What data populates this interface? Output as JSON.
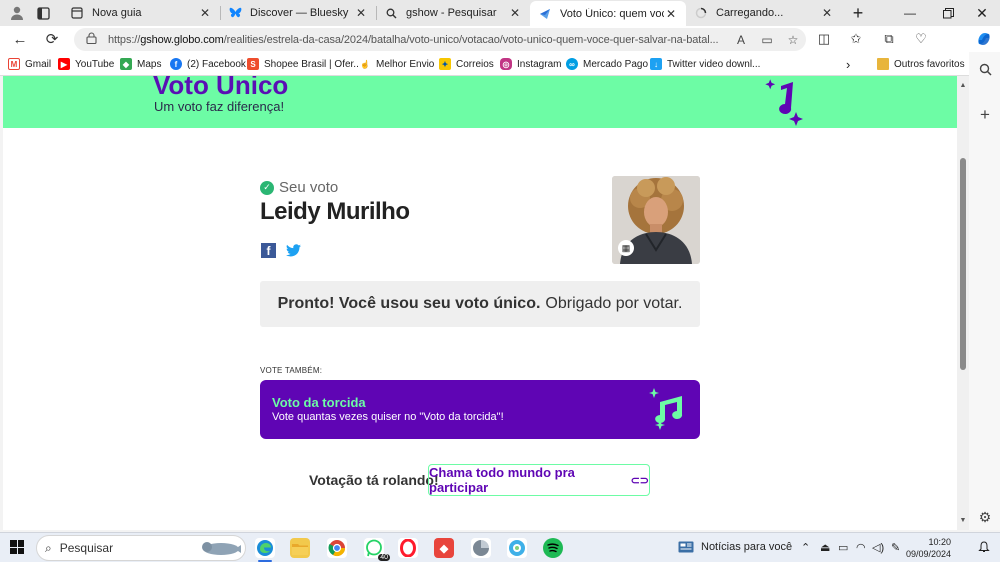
{
  "tabs": [
    {
      "title": "",
      "icon": "profile-icon"
    },
    {
      "title": "",
      "icon": "tab-actions-icon"
    },
    {
      "title": "Nova guia",
      "icon": "new-tab-page-icon"
    },
    {
      "title": "Discover — Bluesky",
      "icon": "bluesky-icon"
    },
    {
      "title": "gshow - Pesquisar",
      "icon": "search-icon"
    },
    {
      "title": "Voto Único: quem você que",
      "icon": "gshow-icon",
      "active": true
    },
    {
      "title": "Carregando...",
      "icon": "loading-icon"
    }
  ],
  "address": {
    "url_prefix": "https://",
    "url_host": "gshow.globo.com",
    "url_path": "/realities/estrela-da-casa/2024/batalha/voto-unico/votacao/voto-unico-quem-voce-quer-salvar-na-batal..."
  },
  "bookmarks": [
    {
      "label": "Gmail",
      "icon": "gmail-icon",
      "color": "#ea4335"
    },
    {
      "label": "YouTube",
      "icon": "youtube-icon",
      "color": "#ff0000"
    },
    {
      "label": "Maps",
      "icon": "maps-icon",
      "color": "#34a853"
    },
    {
      "label": "(2) Facebook",
      "icon": "facebook-icon",
      "color": "#1877f2"
    },
    {
      "label": "Shopee Brasil | Ofer...",
      "icon": "shopee-icon",
      "color": "#ee4d2d"
    },
    {
      "label": "Melhor Envio",
      "icon": "melhor-envio-icon",
      "color": "#f5a623"
    },
    {
      "label": "Correios",
      "icon": "correios-icon",
      "color": "#f7c600"
    },
    {
      "label": "Instagram",
      "icon": "instagram-icon",
      "color": "#c13584"
    },
    {
      "label": "Mercado Pago",
      "icon": "mercado-pago-icon",
      "color": "#009ee3"
    },
    {
      "label": "Twitter video downl...",
      "icon": "twitter-download-icon",
      "color": "#1da1f2"
    }
  ],
  "bookmarks_other": "Outros favoritos",
  "page": {
    "banner_title": "Voto Único",
    "banner_subtitle": "Um voto faz diferença!",
    "your_vote": "Seu voto",
    "candidate": "Leidy Murilho",
    "done_bold": "Pronto! Você usou seu voto único.",
    "done_regular": "Obrigado por votar.",
    "vote_also": "VOTE TAMBÉM:",
    "card_title": "Voto da torcida",
    "card_subtitle": "Vote quantas vezes quiser no \"Voto da torcida\"!",
    "rolando": "Votação tá rolando!",
    "chama": "Chama todo mundo pra participar",
    "brand_colors": {
      "green": "#6dfca5",
      "purple": "#5f05b4"
    }
  },
  "taskbar": {
    "search_placeholder": "Pesquisar",
    "whatsapp_badge": "40",
    "notifications": "Notícias para você",
    "time": "10:20",
    "date": "09/09/2024"
  }
}
